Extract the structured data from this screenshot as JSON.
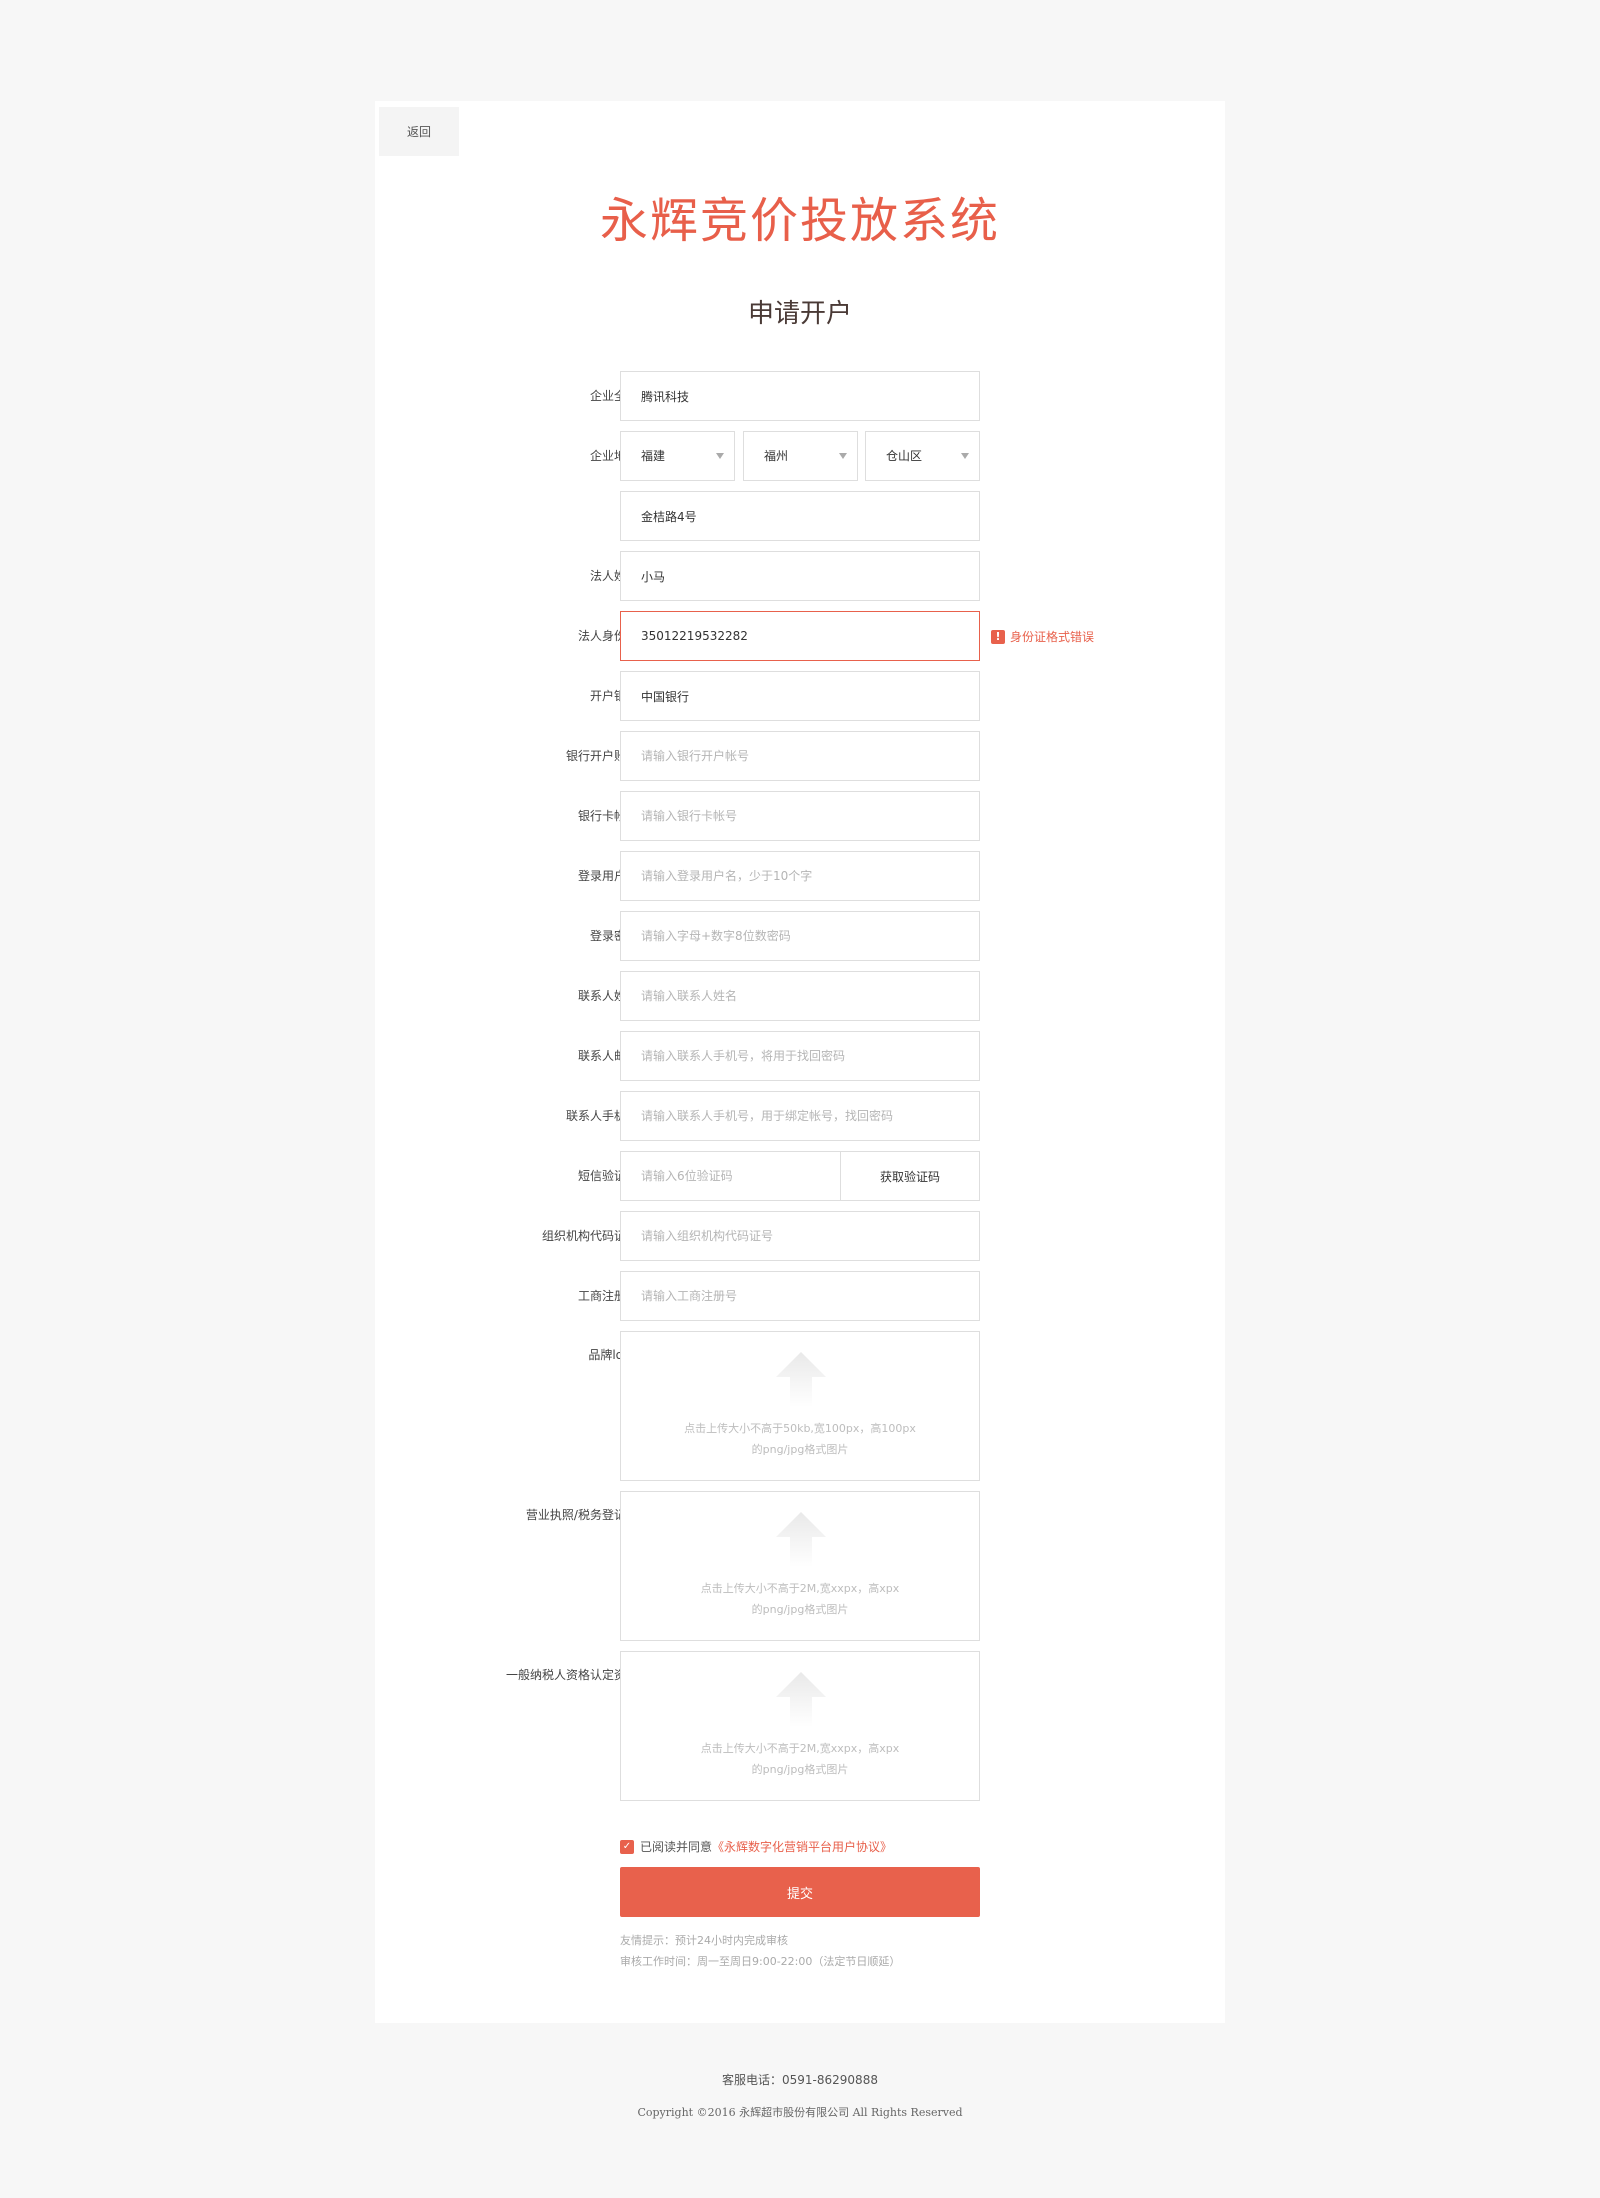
{
  "nav": {
    "back_label": "返回"
  },
  "brand": {
    "logo_text": "永辉竞价投放系统"
  },
  "page_title": "申请开户",
  "form": {
    "company_name": {
      "label": "企业全称:",
      "value": "腾讯科技"
    },
    "address": {
      "label": "企业地址:",
      "province": "福建",
      "city": "福州",
      "district": "仓山区",
      "street": "金桔路4号"
    },
    "legal_name": {
      "label": "法人姓名:",
      "value": "小马"
    },
    "legal_id": {
      "label": "法人身份证:",
      "value": "35012219532282",
      "error": "身份证格式错误"
    },
    "bank": {
      "label": "开户银行:",
      "value": "中国银行"
    },
    "bank_account": {
      "label": "银行开户账号:",
      "placeholder": "请输入银行开户帐号"
    },
    "bank_card": {
      "label": "银行卡帐号:",
      "placeholder": "请输入银行卡帐号"
    },
    "username": {
      "label": "登录用户名:",
      "placeholder": "请输入登录用户名，少于10个字"
    },
    "password": {
      "label": "登录密码:",
      "placeholder": "请输入字母+数字8位数密码"
    },
    "contact_name": {
      "label": "联系人姓名:",
      "placeholder": "请输入联系人姓名"
    },
    "contact_email": {
      "label": "联系人邮箱:",
      "placeholder": "请输入联系人手机号，将用于找回密码"
    },
    "contact_phone": {
      "label": "联系人手机号:",
      "placeholder": "请输入联系人手机号，用于绑定帐号，找回密码"
    },
    "sms_code": {
      "label": "短信验证码:",
      "placeholder": "请输入6位验证码",
      "button": "获取验证码"
    },
    "org_code": {
      "label": "组织机构代码证号:",
      "placeholder": "请输入组织机构代码证号"
    },
    "biz_reg": {
      "label": "工商注册号:",
      "placeholder": "请输入工商注册号"
    },
    "logo_upload": {
      "label": "品牌logo:",
      "hint_line1": "点击上传大小不高于50kb,宽100px，高100px",
      "hint_line2": "的png/jpg格式图片"
    },
    "license_upload": {
      "label": "营业执照/税务登记证:",
      "hint_line1": "点击上传大小不高于2M,宽xxpx，高xpx",
      "hint_line2": "的png/jpg格式图片"
    },
    "taxpayer_upload": {
      "label": "一般纳税人资格认定资料:",
      "hint_line1": "点击上传大小不高于2M,宽xxpx，高xpx",
      "hint_line2": "的png/jpg格式图片"
    }
  },
  "agreement": {
    "prefix": "已阅读并同意",
    "link": "《永辉数字化营销平台用户协议》",
    "checked": true
  },
  "submit_label": "提交",
  "tips": {
    "line1": "友情提示：预计24小时内完成审核",
    "line2": "审核工作时间：周一至周日9:00-22:00（法定节日顺延）"
  },
  "footer": {
    "phone": "客服电话：0591-86290888",
    "copyright": "Copyright ©2016 永辉超市股份有限公司  All Rights Reserved"
  },
  "colors": {
    "accent": "#e8614c",
    "background": "#f7f7f7",
    "card": "#ffffff"
  }
}
